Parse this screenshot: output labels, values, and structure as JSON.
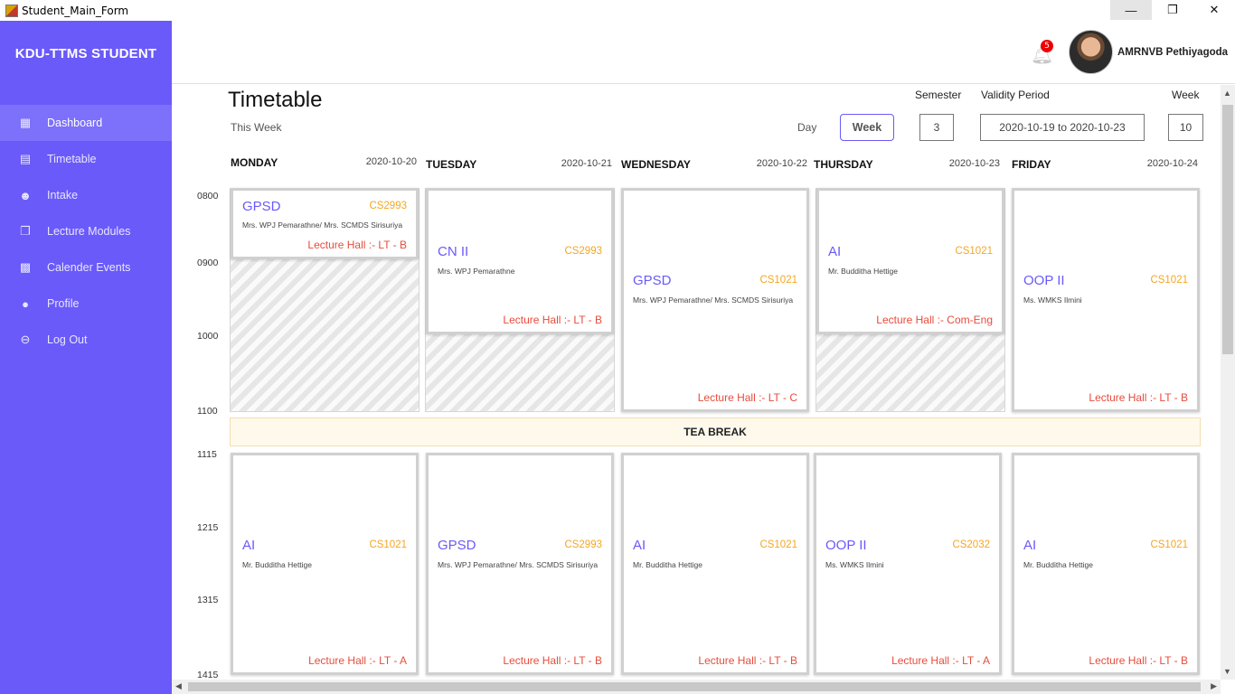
{
  "window": {
    "title": "Student_Main_Form",
    "minimize": "—",
    "maximize": "❐",
    "close": "✕"
  },
  "sidebar": {
    "brand": "KDU-TTMS STUDENT",
    "items": [
      {
        "label": "Dashboard",
        "icon": "dashboard-icon",
        "active": true
      },
      {
        "label": "Timetable",
        "icon": "table-icon"
      },
      {
        "label": "Intake",
        "icon": "group-icon"
      },
      {
        "label": "Lecture Modules",
        "icon": "modules-icon"
      },
      {
        "label": "Calender Events",
        "icon": "calendar-icon"
      },
      {
        "label": "Profile",
        "icon": "profile-icon"
      },
      {
        "label": "Log Out",
        "icon": "logout-icon"
      }
    ]
  },
  "topbar": {
    "notifications": "5",
    "user_name": "AMRNVB Pethiyagoda"
  },
  "header": {
    "title": "Timetable",
    "subtitle": "This Week",
    "day_label": "Day",
    "week_button": "Week",
    "semester_label": "Semester",
    "semester_value": "3",
    "validity_label": "Validity Period",
    "validity_value": "2020-10-19 to 2020-10-23",
    "week_label": "Week",
    "week_value": "10"
  },
  "days": [
    {
      "name": "MONDAY",
      "date": "2020-10-20"
    },
    {
      "name": "TUESDAY",
      "date": "2020-10-21"
    },
    {
      "name": "WEDNESDAY",
      "date": "2020-10-22"
    },
    {
      "name": "THURSDAY",
      "date": "2020-10-23"
    },
    {
      "name": "FRIDAY",
      "date": "2020-10-24"
    }
  ],
  "times": [
    "0800",
    "0900",
    "1000",
    "1100",
    "1115",
    "1215",
    "1315",
    "1415"
  ],
  "break_label": "TEA BREAK",
  "morning": [
    {
      "name": "GPSD",
      "code": "CS2993",
      "lecturer": "Mrs. WPJ Pemarathne/ Mrs. SCMDS Sirisuriya",
      "hall": "Lecture Hall :- LT - B"
    },
    {
      "name": "CN II",
      "code": "CS2993",
      "lecturer": "Mrs. WPJ Pemarathne",
      "hall": "Lecture Hall :- LT - B"
    },
    {
      "name": "GPSD",
      "code": "CS1021",
      "lecturer": "Mrs. WPJ Pemarathne/ Mrs. SCMDS Sirisuriya",
      "hall": "Lecture Hall :- LT - C"
    },
    {
      "name": "AI",
      "code": "CS1021",
      "lecturer": "Mr. Budditha Hettige",
      "hall": "Lecture Hall :- Com-Eng"
    },
    {
      "name": "OOP II",
      "code": "CS1021",
      "lecturer": "Ms. WMKS Ilmini",
      "hall": "Lecture Hall :- LT - B"
    }
  ],
  "afternoon": [
    {
      "name": "AI",
      "code": "CS1021",
      "lecturer": "Mr. Budditha Hettige",
      "hall": "Lecture Hall :- LT - A"
    },
    {
      "name": "GPSD",
      "code": "CS2993",
      "lecturer": "Mrs. WPJ Pemarathne/ Mrs. SCMDS Sirisuriya",
      "hall": "Lecture Hall :- LT - B"
    },
    {
      "name": "AI",
      "code": "CS1021",
      "lecturer": "Mr. Budditha Hettige",
      "hall": "Lecture Hall :- LT - B"
    },
    {
      "name": "OOP II",
      "code": "CS2032",
      "lecturer": "Ms. WMKS Ilmini",
      "hall": "Lecture Hall :- LT - A"
    },
    {
      "name": "AI",
      "code": "CS1021",
      "lecturer": "Mr. Budditha Hettige",
      "hall": "Lecture Hall :- LT - B"
    }
  ],
  "colors": {
    "accent": "#6a5af9",
    "code": "#f5a623",
    "hall": "#e74c3c",
    "break_bg": "#fff9ec"
  }
}
